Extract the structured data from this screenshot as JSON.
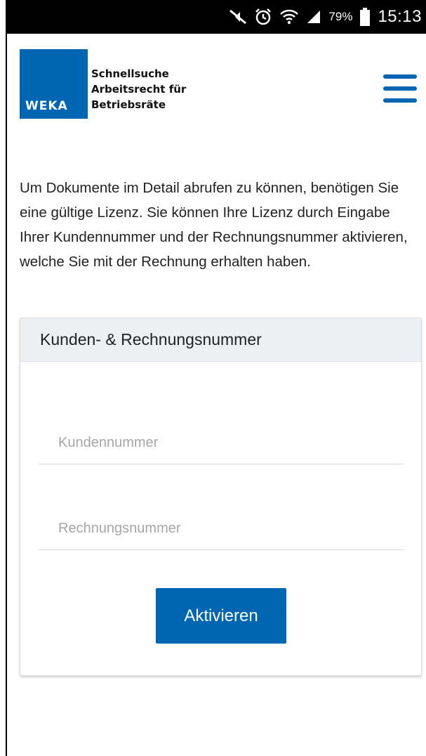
{
  "statusbar": {
    "icons": [
      "mute-icon",
      "alarm-icon",
      "wifi-icon",
      "signal-icon",
      "battery-icon"
    ],
    "battery_percent": "79%",
    "time": "15:13"
  },
  "header": {
    "logo_word": "WEKA",
    "title_lines": [
      "Schnellsuche",
      "Arbeitsrecht für",
      "Betriebsräte"
    ],
    "menu_icon": "hamburger-menu-icon",
    "brand_color": "#0065b3"
  },
  "intro_text": "Um Dokumente im Detail abrufen zu können, benötigen Sie eine gültige Lizenz. Sie können Ihre Lizenz durch Eingabe Ihrer Kundennummer und der Rechnungsnummer aktivieren, welche Sie mit der Rechnung erhalten haben.",
  "card": {
    "title": "Kunden- & Rechnungsnummer",
    "customer_field": {
      "placeholder": "Kundennummer",
      "value": ""
    },
    "invoice_field": {
      "placeholder": "Rechnungsnummer",
      "value": ""
    },
    "submit_label": "Aktivieren"
  }
}
